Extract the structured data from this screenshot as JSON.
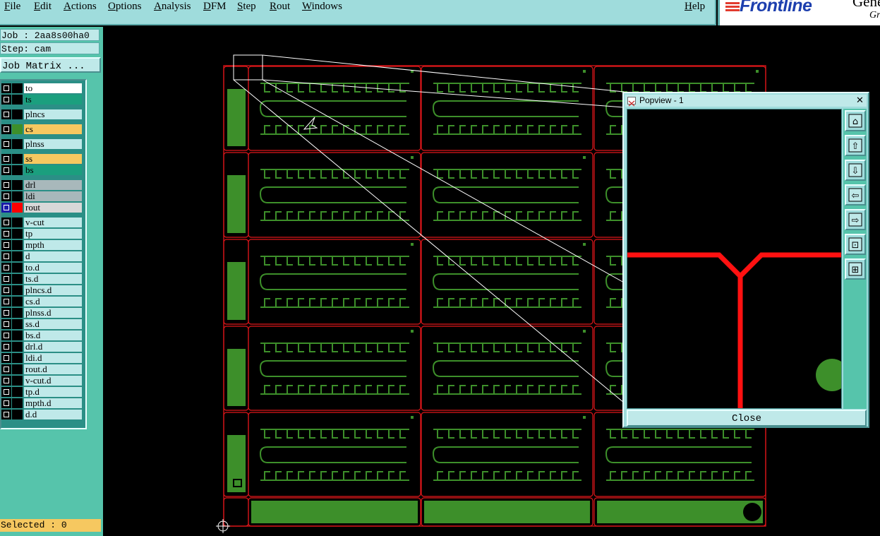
{
  "menubar": {
    "items": [
      "File",
      "Edit",
      "Actions",
      "Options",
      "Analysis",
      "DFM",
      "Step",
      "Rout",
      "Windows"
    ],
    "help": "Help"
  },
  "brand": {
    "name": "Frontline",
    "product": "Genesis",
    "subtitle": "Graph"
  },
  "info": {
    "job": "Job : 2aa8s00ha0",
    "step": "Step: cam"
  },
  "job_matrix_button": "Job Matrix ...",
  "layers": [
    {
      "name": "to",
      "bg": "#ffffff",
      "swatch": "#000000",
      "box": "#000000"
    },
    {
      "name": "ts",
      "bg": "#1b9f7e",
      "swatch": "#000000",
      "box": "#000000"
    },
    {
      "name": "plncs",
      "bg": "#bfe9e9",
      "swatch": "#000000",
      "box": "#000000"
    },
    {
      "name": "cs",
      "bg": "#f6c860",
      "swatch": "#3d8f2a",
      "box": "#000000"
    },
    {
      "name": "plnss",
      "bg": "#bfe9e9",
      "swatch": "#000000",
      "box": "#000000"
    },
    {
      "name": "ss",
      "bg": "#f6c860",
      "swatch": "#000000",
      "box": "#000000"
    },
    {
      "name": "bs",
      "bg": "#1b9f7e",
      "swatch": "#000000",
      "box": "#000000"
    },
    {
      "name": "drl",
      "bg": "#a8b8bb",
      "swatch": "#000000",
      "box": "#000000"
    },
    {
      "name": "ldi",
      "bg": "#a8b8bb",
      "swatch": "#000000",
      "box": "#000000"
    },
    {
      "name": "rout",
      "bg": "#d8d8d8",
      "swatch": "#ff0000",
      "box": "#1a1aa8"
    },
    {
      "name": "v-cut",
      "bg": "#bfe9e9",
      "swatch": "#000000",
      "box": "#000000"
    },
    {
      "name": "tp",
      "bg": "#bfe9e9",
      "swatch": "#000000",
      "box": "#000000"
    },
    {
      "name": "mpth",
      "bg": "#bfe9e9",
      "swatch": "#000000",
      "box": "#000000"
    },
    {
      "name": "d",
      "bg": "#bfe9e9",
      "swatch": "#000000",
      "box": "#000000"
    },
    {
      "name": "to.d",
      "bg": "#bfe9e9",
      "swatch": "#000000",
      "box": "#000000"
    },
    {
      "name": "ts.d",
      "bg": "#bfe9e9",
      "swatch": "#000000",
      "box": "#000000"
    },
    {
      "name": "plncs.d",
      "bg": "#bfe9e9",
      "swatch": "#000000",
      "box": "#000000"
    },
    {
      "name": "cs.d",
      "bg": "#bfe9e9",
      "swatch": "#000000",
      "box": "#000000"
    },
    {
      "name": "plnss.d",
      "bg": "#bfe9e9",
      "swatch": "#000000",
      "box": "#000000"
    },
    {
      "name": "ss.d",
      "bg": "#bfe9e9",
      "swatch": "#000000",
      "box": "#000000"
    },
    {
      "name": "bs.d",
      "bg": "#bfe9e9",
      "swatch": "#000000",
      "box": "#000000"
    },
    {
      "name": "drl.d",
      "bg": "#bfe9e9",
      "swatch": "#000000",
      "box": "#000000"
    },
    {
      "name": "ldi.d",
      "bg": "#bfe9e9",
      "swatch": "#000000",
      "box": "#000000"
    },
    {
      "name": "rout.d",
      "bg": "#bfe9e9",
      "swatch": "#000000",
      "box": "#000000"
    },
    {
      "name": "v-cut.d",
      "bg": "#bfe9e9",
      "swatch": "#000000",
      "box": "#000000"
    },
    {
      "name": "tp.d",
      "bg": "#bfe9e9",
      "swatch": "#000000",
      "box": "#000000"
    },
    {
      "name": "mpth.d",
      "bg": "#bfe9e9",
      "swatch": "#000000",
      "box": "#000000"
    },
    {
      "name": "d.d",
      "bg": "#bfe9e9",
      "swatch": "#000000",
      "box": "#000000"
    }
  ],
  "selected": "Selected : 0",
  "popview": {
    "title": "Popview - 1",
    "close_label": "Close"
  },
  "colors": {
    "outline": "#e0161a",
    "copper": "#3d8f2a",
    "route": "#ff1111",
    "panel": "#9fdcdc"
  },
  "icons": {
    "menu": "window-menu-icon",
    "close": "close-icon",
    "tools": [
      "zoom-home-icon",
      "pan-up-icon",
      "pan-down-icon",
      "pan-left-icon",
      "pan-right-icon",
      "zoom-out-icon",
      "zoom-in-icon"
    ]
  }
}
